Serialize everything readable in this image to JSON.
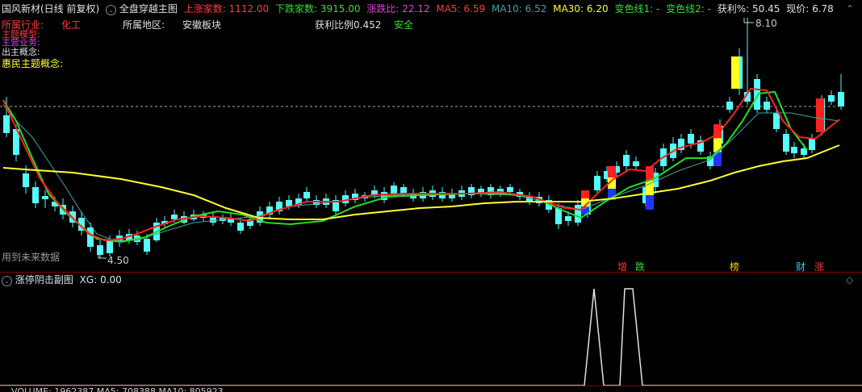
{
  "main_header": {
    "stock_name": "国风新材(日线 前复权)",
    "indicator_name": "全盘穿越主图",
    "up_count_label": "上涨家数: ",
    "up_count_value": "1112.00",
    "down_count_label": "下跌家数: ",
    "down_count_value": "3915.00",
    "ratio_label": "涨跌比: ",
    "ratio_value": "22.12",
    "ma5_label": "MA5: ",
    "ma5_value": "6.59",
    "ma10_label": "MA10: ",
    "ma10_value": "6.52",
    "ma30_label": "MA30: ",
    "ma30_value": "6.20",
    "line1_label": "变色线1: -",
    "line2_label": "变色线2: -",
    "profit_label": "获利%: ",
    "profit_value": "50.45",
    "price_label": "现价: ",
    "price_value": "6.78"
  },
  "info": {
    "industry_label": "所属行业:",
    "industry_value": "化工",
    "region_label": "所属地区:",
    "region_value": "安徽板块",
    "profit_ratio_label": "获利比例",
    "profit_ratio_value": "0.452",
    "safety_value": "安全",
    "overlap1": "主题模型:",
    "overlap2": "主营业务:",
    "overlap3": "出主概念:",
    "concept_label": "惠民主题概念:"
  },
  "annotations": {
    "high_price": "8.10",
    "low_price": "4.50",
    "future_data": "用到未来数据"
  },
  "tags": [
    {
      "text": "增",
      "color": "#ff3333"
    },
    {
      "text": "跌",
      "color": "#33dd33"
    },
    {
      "text": "榜",
      "color": "#ffcc00"
    },
    {
      "text": "财",
      "color": "#33ccff"
    },
    {
      "text": "涨",
      "color": "#ff3333"
    }
  ],
  "sub_header": {
    "title": "涨停阴击副图",
    "xg_label": "XG: ",
    "xg_value": "0.00"
  },
  "bottom_partial": "VOLUME: 1962387  MA5: 708388  MA10: 805923",
  "colors": {
    "up": "#ff3b3b",
    "down": "#54fcfc",
    "ma_red": "#ff2020",
    "ma_green": "#22dd22",
    "ma_yellow": "#ffff33",
    "ma_teal": "#3aa6a6"
  },
  "chart_data": {
    "type": "candlestick",
    "high": 8.1,
    "low": 4.5,
    "signal_series": [
      0,
      0,
      0,
      0,
      1,
      1,
      0,
      0,
      0
    ]
  }
}
